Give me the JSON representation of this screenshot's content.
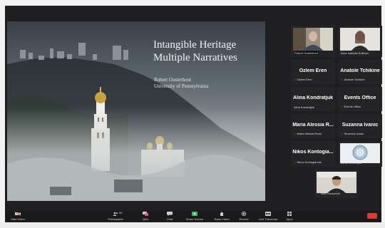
{
  "slide": {
    "title_line1": "Intangible Heritage",
    "title_line2": "Multiple Narratives",
    "author": "Robert Ousterhout",
    "affiliation": "University of Pennsylvania"
  },
  "participants": [
    {
      "tile_name": "Robert Ousterhout",
      "has_video": true
    },
    {
      "tile_name": "Alice Isabella Sullivan",
      "has_video": true
    },
    {
      "display_name": "Özlem Eren",
      "tile_name": "Özlem Eren",
      "muted": true
    },
    {
      "display_name": "Anatole Tchikine",
      "tile_name": "Anatole Tchikine",
      "muted": true
    },
    {
      "display_name": "Alina Kondratjuk",
      "tile_name": "Alina Kondratjuk",
      "muted": false
    },
    {
      "display_name": "Events Office",
      "tile_name": "Events Office",
      "muted": true
    },
    {
      "display_name": "Maria Alessia R...",
      "tile_name": "Maria Alessia Rossi",
      "muted": true
    },
    {
      "display_name": "Suzanna Ivanic",
      "tile_name": "Suzanna Ivanic",
      "muted": true
    },
    {
      "display_name": "Nikos Kontogia...",
      "tile_name": "Nikos Kontogiannis",
      "muted": true
    },
    {
      "tile_name": "Alina Kondratjuk",
      "has_video": true
    },
    {
      "tile_name": "Stan Gruszecki",
      "has_video": true,
      "muted": true
    }
  ],
  "toolbar": {
    "start_video": "Start Video",
    "participants": "Participants",
    "participants_count": "56",
    "qa": "Q&A",
    "chat": "Chat",
    "share_screen": "Share Screen",
    "raise_hand": "Raise Hand",
    "record": "Record",
    "live_transcript": "Live Transcript",
    "apps": "Apps"
  },
  "colors": {
    "muted_icon": "#e0453a",
    "share_screen": "#2dbe6c",
    "end_button": "#e03a2f"
  }
}
